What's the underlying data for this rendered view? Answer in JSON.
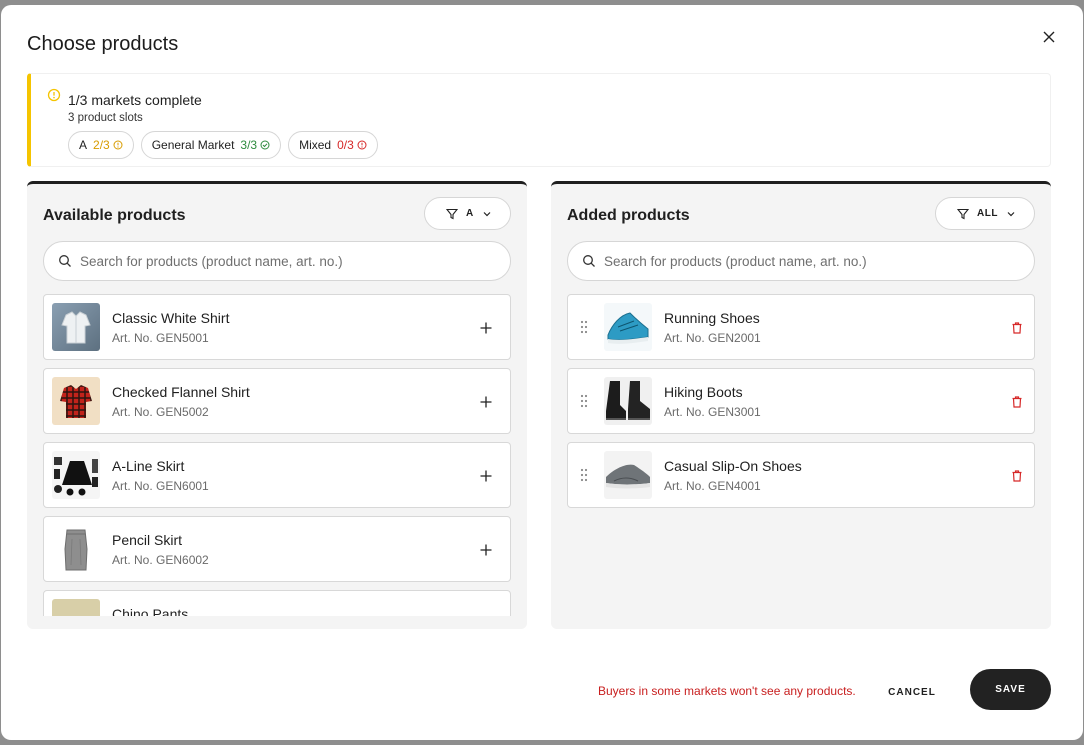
{
  "modal": {
    "title": "Choose products"
  },
  "banner": {
    "title": "1/3 markets complete",
    "subtitle": "3 product slots",
    "chips": [
      {
        "market": "A",
        "count": "2/3",
        "status": "warning",
        "color": "#d89c00"
      },
      {
        "market": "General Market",
        "count": "3/3",
        "status": "complete",
        "color": "#2e8b3e"
      },
      {
        "market": "Mixed",
        "count": "0/3",
        "status": "error",
        "color": "#d62828"
      }
    ]
  },
  "available": {
    "title": "Available products",
    "filter_label": "A",
    "search_placeholder": "Search for products (product name, art. no.)",
    "items": [
      {
        "name": "Classic White Shirt",
        "art": "Art. No. GEN5001",
        "icon": "white-shirt-thumbnail"
      },
      {
        "name": "Checked Flannel Shirt",
        "art": "Art. No. GEN5002",
        "icon": "flannel-shirt-thumbnail"
      },
      {
        "name": "A-Line Skirt",
        "art": "Art. No. GEN6001",
        "icon": "a-line-skirt-thumbnail"
      },
      {
        "name": "Pencil Skirt",
        "art": "Art. No. GEN6002",
        "icon": "pencil-skirt-thumbnail"
      },
      {
        "name": "Chino Pants",
        "art": "",
        "icon": "chino-pants-thumbnail"
      }
    ]
  },
  "added": {
    "title": "Added products",
    "filter_label": "ALL",
    "search_placeholder": "Search for products (product name, art. no.)",
    "items": [
      {
        "name": "Running Shoes",
        "art": "Art. No. GEN2001",
        "icon": "running-shoes-thumbnail"
      },
      {
        "name": "Hiking Boots",
        "art": "Art. No. GEN3001",
        "icon": "hiking-boots-thumbnail"
      },
      {
        "name": "Casual Slip-On Shoes",
        "art": "Art. No. GEN4001",
        "icon": "slip-on-shoes-thumbnail"
      }
    ]
  },
  "footer": {
    "warning": "Buyers in some markets won't see any products.",
    "cancel_label": "CANCEL",
    "save_label": "SAVE"
  },
  "colors": {
    "accent_warning": "#f5c400",
    "error": "#c81e1e",
    "primary_button": "#222222"
  }
}
